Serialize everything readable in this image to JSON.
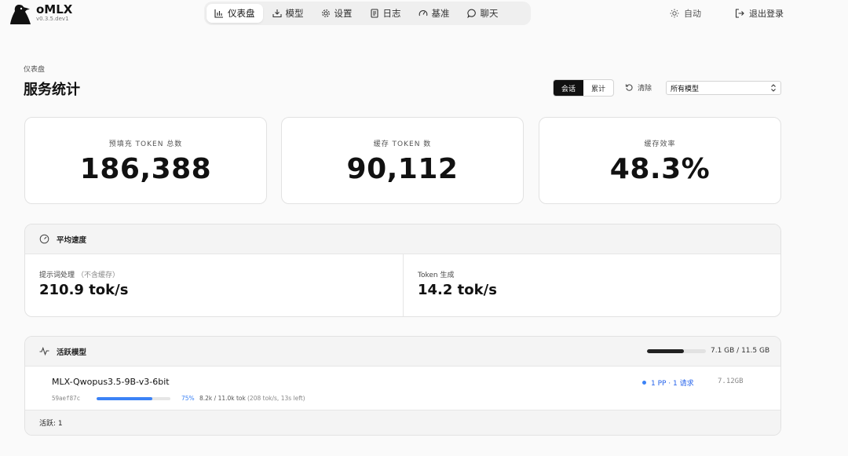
{
  "app": {
    "name": "oMLX",
    "version": "v0.3.5.dev1"
  },
  "nav": [
    {
      "label": "仪表盘",
      "icon": "bar-chart-icon"
    },
    {
      "label": "模型",
      "icon": "download-icon"
    },
    {
      "label": "设置",
      "icon": "gear-icon"
    },
    {
      "label": "日志",
      "icon": "log-icon"
    },
    {
      "label": "基准",
      "icon": "gauge-icon"
    },
    {
      "label": "聊天",
      "icon": "chat-icon"
    }
  ],
  "header_right": {
    "theme_label": "自动",
    "logout_label": "退出登录"
  },
  "page": {
    "breadcrumb": "仪表盘",
    "title": "服务统计",
    "scope_tabs": [
      "会话",
      "累计"
    ],
    "reset_label": "清除",
    "model_filter": "所有模型"
  },
  "stats": [
    {
      "label": "预填充 TOKEN 总数",
      "value": "186,388"
    },
    {
      "label": "缓存 TOKEN 数",
      "value": "90,112"
    },
    {
      "label": "缓存效率",
      "value": "48.3%"
    }
  ],
  "speed": {
    "title": "平均速度",
    "prompt_label": "提示词处理",
    "prompt_note": "（不含缓存）",
    "prompt_value": "210.9 tok/s",
    "gen_label": "Token 生成",
    "gen_value": "14.2 tok/s"
  },
  "active": {
    "title": "活跃模型",
    "memory_text": "7.1 GB / 11.5 GB",
    "memory_fraction": 0.62,
    "model": {
      "name": "MLX-Qwopus3.5-9B-v3-6bit",
      "hash": "59aef87c",
      "progress_fraction": 0.75,
      "progress_pct": "75%",
      "tokens": "8.2k / 11.0k tok",
      "rate": "(208 tok/s, 13s left)",
      "status": "1 PP · 1 请求",
      "size": "7.12GB"
    },
    "footer": "活跃: 1"
  },
  "colors": {
    "accent": "#3b82f6",
    "dark": "#111111"
  }
}
